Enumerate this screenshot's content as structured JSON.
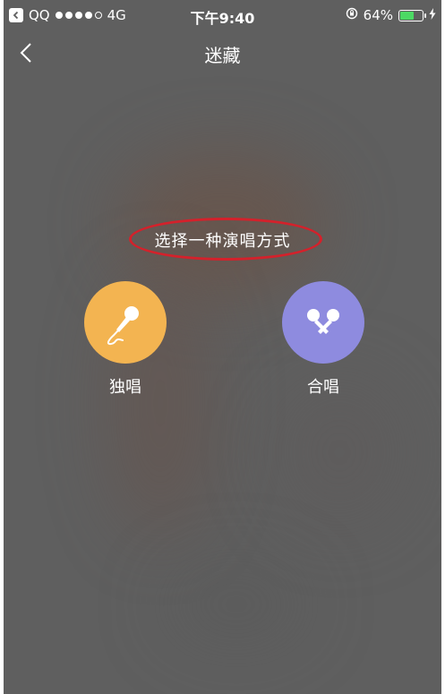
{
  "status_bar": {
    "back_app": "QQ",
    "network": "4G",
    "time": "下午9:40",
    "battery_percent": "64%",
    "battery_level": 0.64,
    "signal_bars_filled": 4,
    "signal_bars_total": 5,
    "icons": [
      "back-arrow-icon",
      "signal-dots-icon",
      "orientation-lock-icon",
      "battery-icon",
      "charging-bolt-icon"
    ]
  },
  "nav": {
    "title": "迷藏",
    "back_icon": "chevron-left-icon"
  },
  "main": {
    "prompt": "选择一种演唱方式",
    "options": [
      {
        "label": "独唱",
        "icon": "microphone-icon",
        "color": "#f3b451"
      },
      {
        "label": "合唱",
        "icon": "two-microphones-icon",
        "color": "#8e8bdf"
      }
    ]
  },
  "colors": {
    "background": "#5f5f5f",
    "highlight_oval": "#d4212b",
    "battery_fill": "#4cd964"
  }
}
